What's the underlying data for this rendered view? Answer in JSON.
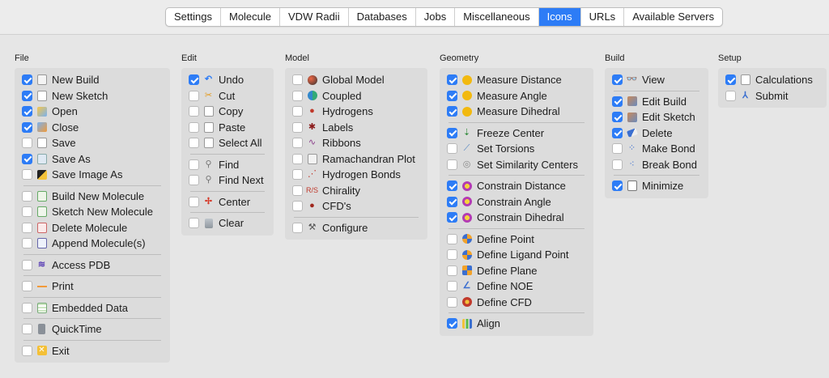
{
  "tabs": [
    "Settings",
    "Molecule",
    "VDW Radii",
    "Databases",
    "Jobs",
    "Miscellaneous",
    "Icons",
    "URLs",
    "Available Servers"
  ],
  "active_tab": "Icons",
  "groups": {
    "file": {
      "title": "File",
      "items": [
        {
          "label": "New Build",
          "checked": true
        },
        {
          "label": "New Sketch",
          "checked": true
        },
        {
          "label": "Open",
          "checked": true
        },
        {
          "label": "Close",
          "checked": true
        },
        {
          "label": "Save",
          "checked": false
        },
        {
          "label": "Save As",
          "checked": true
        },
        {
          "label": "Save Image As",
          "checked": false
        },
        {
          "label": "Build New Molecule",
          "checked": false
        },
        {
          "label": "Sketch New Molecule",
          "checked": false
        },
        {
          "label": "Delete Molecule",
          "checked": false
        },
        {
          "label": "Append Molecule(s)",
          "checked": false
        },
        {
          "label": "Access PDB",
          "checked": false
        },
        {
          "label": "Print",
          "checked": false
        },
        {
          "label": "Embedded Data",
          "checked": false
        },
        {
          "label": "QuickTime",
          "checked": false
        },
        {
          "label": "Exit",
          "checked": false
        }
      ]
    },
    "edit": {
      "title": "Edit",
      "items": [
        {
          "label": "Undo",
          "checked": true
        },
        {
          "label": "Cut",
          "checked": false
        },
        {
          "label": "Copy",
          "checked": false
        },
        {
          "label": "Paste",
          "checked": false
        },
        {
          "label": "Select All",
          "checked": false
        },
        {
          "label": "Find",
          "checked": false
        },
        {
          "label": "Find Next",
          "checked": false
        },
        {
          "label": "Center",
          "checked": false
        },
        {
          "label": "Clear",
          "checked": false
        }
      ]
    },
    "model": {
      "title": "Model",
      "items": [
        {
          "label": "Global Model",
          "checked": false
        },
        {
          "label": "Coupled",
          "checked": false
        },
        {
          "label": "Hydrogens",
          "checked": false
        },
        {
          "label": "Labels",
          "checked": false
        },
        {
          "label": "Ribbons",
          "checked": false
        },
        {
          "label": "Ramachandran Plot",
          "checked": false
        },
        {
          "label": "Hydrogen Bonds",
          "checked": false
        },
        {
          "label": "Chirality",
          "checked": false
        },
        {
          "label": "CFD's",
          "checked": false
        },
        {
          "label": "Configure",
          "checked": false
        }
      ]
    },
    "geometry": {
      "title": "Geometry",
      "items": [
        {
          "label": "Measure Distance",
          "checked": true
        },
        {
          "label": "Measure Angle",
          "checked": true
        },
        {
          "label": "Measure Dihedral",
          "checked": true
        },
        {
          "label": "Freeze Center",
          "checked": true
        },
        {
          "label": "Set Torsions",
          "checked": false
        },
        {
          "label": "Set Similarity Centers",
          "checked": false
        },
        {
          "label": "Constrain Distance",
          "checked": true
        },
        {
          "label": "Constrain Angle",
          "checked": true
        },
        {
          "label": "Constrain Dihedral",
          "checked": true
        },
        {
          "label": "Define Point",
          "checked": false
        },
        {
          "label": "Define Ligand Point",
          "checked": false
        },
        {
          "label": "Define Plane",
          "checked": false
        },
        {
          "label": "Define NOE",
          "checked": false
        },
        {
          "label": "Define CFD",
          "checked": false
        },
        {
          "label": "Align",
          "checked": true
        }
      ]
    },
    "build": {
      "title": "Build",
      "items": [
        {
          "label": "View",
          "checked": true
        },
        {
          "label": "Edit Build",
          "checked": true
        },
        {
          "label": "Edit Sketch",
          "checked": true
        },
        {
          "label": "Delete",
          "checked": true
        },
        {
          "label": "Make Bond",
          "checked": false
        },
        {
          "label": "Break Bond",
          "checked": false
        },
        {
          "label": "Minimize",
          "checked": true
        }
      ]
    },
    "setup": {
      "title": "Setup",
      "items": [
        {
          "label": "Calculations",
          "checked": true
        },
        {
          "label": "Submit",
          "checked": false
        }
      ]
    }
  },
  "colors": {
    "accent": "#2d7cf6",
    "panel": "#dcdcdc",
    "background": "#ececec"
  }
}
